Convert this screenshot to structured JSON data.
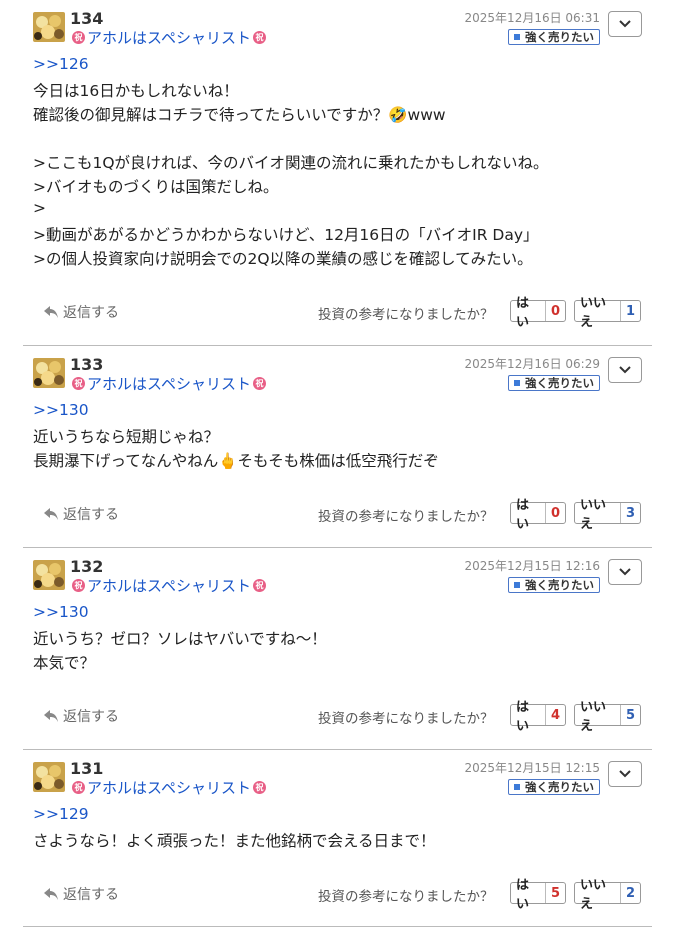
{
  "common": {
    "author": "アホルはスペシャリスト",
    "stance": "強く売りたい",
    "reply_label": "返信する",
    "question": "投資の参考になりましたか？",
    "yes_label": "はい",
    "no_label": "いいえ",
    "celebrate_char": "祝"
  },
  "posts": [
    {
      "number": "134",
      "date": "2025年12月16日 06:31",
      "anchor": ">>126",
      "lines": [
        "今日は16日かもしれないね！",
        "確認後の御見解はコチラで待ってたらいいですか？🤣www",
        "",
        ">ここも1Qが良ければ、今のバイオ関連の流れに乗れたかもしれないね。",
        ">バイオものづくりは国策だしね。",
        ">",
        ">動画があがるかどうかわからないけど、12月16日の「バイオIR Day」",
        ">の個人投資家向け説明会での2Q以降の業績の感じを確認してみたい。"
      ],
      "yes": "0",
      "no": "1"
    },
    {
      "number": "133",
      "date": "2025年12月16日 06:29",
      "anchor": ">>130",
      "lines": [
        "近いうちなら短期じゃね？",
        "長期瀑下げってなんやねん🖕そもそも株価は低空飛行だぞ"
      ],
      "yes": "0",
      "no": "3"
    },
    {
      "number": "132",
      "date": "2025年12月15日 12:16",
      "anchor": ">>130",
      "lines": [
        "近いうち？ゼロ？ソレはヤバいですね～！",
        "本気で？"
      ],
      "yes": "4",
      "no": "5"
    },
    {
      "number": "131",
      "date": "2025年12月15日 12:15",
      "anchor": ">>129",
      "lines": [
        "さようなら！よく頑張った！また他銘柄で会える日まで！"
      ],
      "yes": "5",
      "no": "2"
    }
  ]
}
